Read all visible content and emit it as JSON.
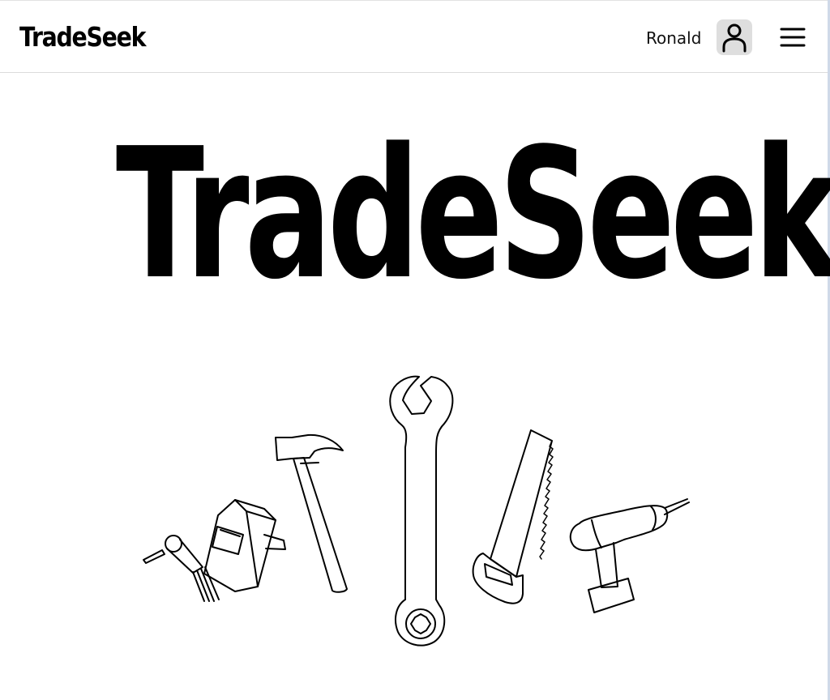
{
  "navbar": {
    "brand": "TradeSeek",
    "user_name": "Ronald",
    "avatar_icon": "user-icon",
    "menu_icon": "hamburger-menu-icon"
  },
  "hero": {
    "title": "TradeSeek",
    "illustration_icons": [
      "welder-icon",
      "hammer-icon",
      "wrench-icon",
      "saw-icon",
      "drill-icon"
    ]
  }
}
